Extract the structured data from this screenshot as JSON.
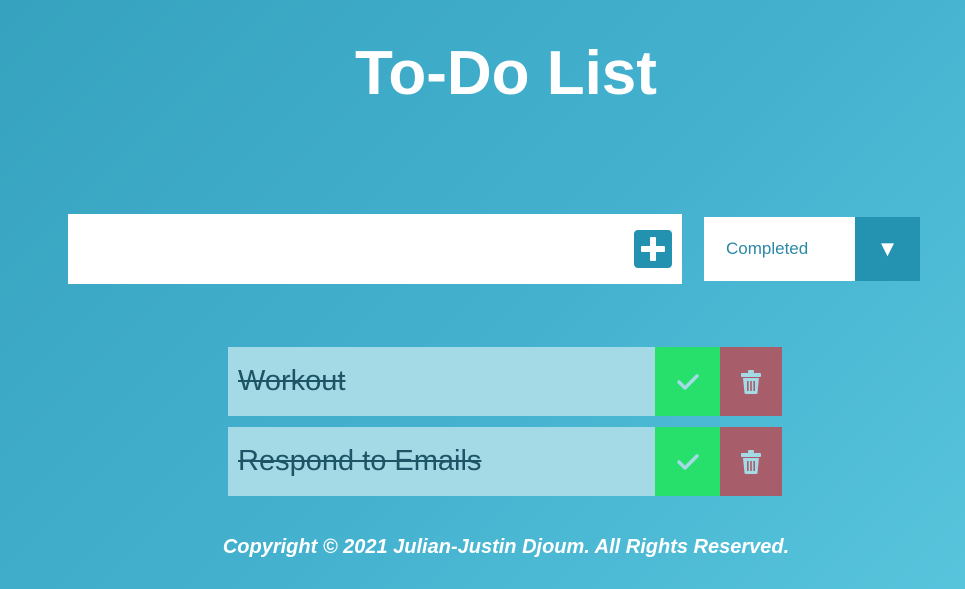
{
  "header": {
    "title": "To-Do List"
  },
  "form": {
    "input_value": "",
    "input_placeholder": "",
    "add_icon": "plus-square-icon",
    "filter": {
      "selected": "Completed",
      "arrow": "▼"
    }
  },
  "todos": [
    {
      "text": "Workout",
      "completed": true
    },
    {
      "text": "Respond to Emails",
      "completed": true
    }
  ],
  "footer": {
    "copyright": "Copyright © 2021 Julian-Justin Djoum. All Rights Reserved."
  },
  "colors": {
    "accent": "#2393b1",
    "complete": "#27e06b",
    "trash": "#a75e6a",
    "item_background": "#a4d9e6"
  }
}
